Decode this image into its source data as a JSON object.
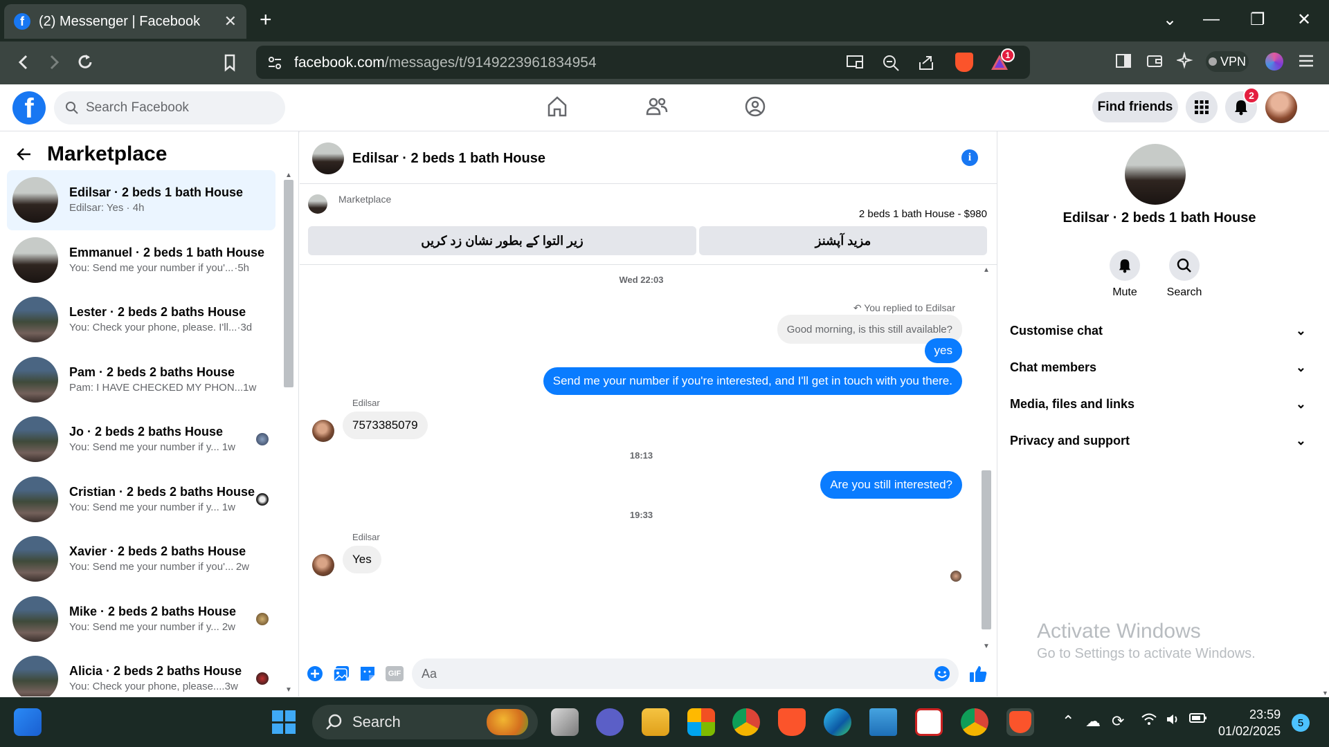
{
  "browser": {
    "tab_title": "(2) Messenger | Facebook",
    "url_domain": "facebook.com",
    "url_path": "/messages/t/9149223961834954",
    "vpn_label": "VPN",
    "brave_badge": "1"
  },
  "fb": {
    "search_placeholder": "Search Facebook",
    "find_friends": "Find friends",
    "notification_count": "2"
  },
  "left": {
    "title": "Marketplace",
    "conversations": [
      {
        "name": "Edilsar · 2 beds 1 bath House",
        "preview": "Edilsar: Yes",
        "time": "4h"
      },
      {
        "name": "Emmanuel · 2 beds 1 bath House",
        "preview": "You: Send me your number if you'...",
        "time": "5h"
      },
      {
        "name": "Lester · 2 beds 2 baths House",
        "preview": "You: Check your phone, please. I'll...",
        "time": "3d"
      },
      {
        "name": "Pam · 2 beds 2 baths House",
        "preview": "Pam: I HAVE CHECKED MY PHON...",
        "time": "1w"
      },
      {
        "name": "Jo · 2 beds 2 baths House",
        "preview": "You: Send me your number if y...",
        "time": "1w"
      },
      {
        "name": "Cristian · 2 beds 2 baths House",
        "preview": "You: Send me your number if y...",
        "time": "1w"
      },
      {
        "name": "Xavier · 2 beds 2 baths House",
        "preview": "You: Send me your number if you'...",
        "time": "2w"
      },
      {
        "name": "Mike · 2 beds 2 baths House",
        "preview": "You: Send me your number if y...",
        "time": "2w"
      },
      {
        "name": "Alicia · 2 beds 2 baths House",
        "preview": "You: Check your phone, please....",
        "time": "3w"
      }
    ]
  },
  "chat": {
    "title": "Edilsar · 2 beds 1 bath House",
    "marketplace_label": "Marketplace",
    "listing_price": "2 beds 1 bath House - $980",
    "btn_mark_pending": "زیر التوا کے بطور نشان زد کریں",
    "btn_more_options": "مزید آپشنز",
    "ts1": "Wed 22:03",
    "replied_to": "You replied to Edilsar",
    "quoted": "Good morning, is this still available?",
    "msg_yes": "yes",
    "msg_send_number": "Send me your number if you're interested, and I'll get in touch with you there.",
    "sender1": "Edilsar",
    "msg_phone": "7573385079",
    "ts2": "18:13",
    "msg_still": "Are you still interested?",
    "ts3": "19:33",
    "sender2": "Edilsar",
    "msg_yes2": "Yes",
    "composer_placeholder": "Aa",
    "gif_label": "GIF"
  },
  "right": {
    "name": "Edilsar · 2 beds 1 bath House",
    "mute": "Mute",
    "search": "Search",
    "rows": [
      "Customise chat",
      "Chat members",
      "Media, files and links",
      "Privacy and support"
    ]
  },
  "watermark": {
    "line1": "Activate Windows",
    "line2": "Go to Settings to activate Windows."
  },
  "taskbar": {
    "search": "Search",
    "time": "23:59",
    "date": "01/02/2025",
    "notifications": "5"
  },
  "colors": {
    "fb_blue": "#1877f2",
    "bubble_out": "#0a7cff",
    "active_conv": "#ebf5ff"
  }
}
